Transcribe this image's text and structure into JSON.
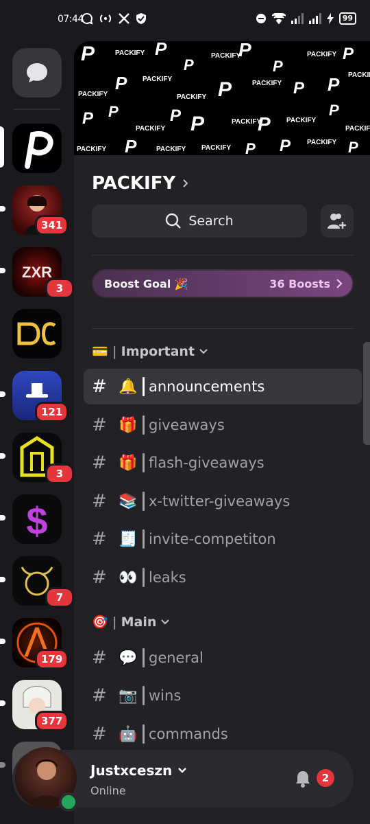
{
  "status_bar": {
    "time": "07:44",
    "battery": "99"
  },
  "rail": {
    "servers": [
      {
        "name": "PACKIFY",
        "badge": "",
        "active": true,
        "color": "#000000"
      },
      {
        "name": "server-2",
        "badge": "341",
        "color": "#5a1010"
      },
      {
        "name": "ZXR",
        "badge": "3",
        "color": "#3a0808"
      },
      {
        "name": "DC",
        "badge": "",
        "color": "#050505"
      },
      {
        "name": "server-5",
        "badge": "121",
        "color": "#1e2f8f"
      },
      {
        "name": "server-6",
        "badge": "3",
        "color": "#0a0a0a"
      },
      {
        "name": "server-7",
        "badge": "",
        "color": "#0a0a0a"
      },
      {
        "name": "server-8",
        "badge": "7",
        "color": "#0a0a0a"
      },
      {
        "name": "server-9",
        "badge": "179",
        "color": "#1a0500"
      },
      {
        "name": "server-10",
        "badge": "377",
        "color": "#e8e6e0"
      }
    ]
  },
  "server": {
    "name": "PACKIFY",
    "search_label": "Search",
    "boost": {
      "label": "Boost Goal 🎉",
      "count": "36 Boosts"
    }
  },
  "categories": [
    {
      "emoji": "💳",
      "label": "Important",
      "channels": [
        {
          "emoji": "🔔",
          "name": "announcements",
          "active": true
        },
        {
          "emoji": "🎁",
          "name": "giveaways"
        },
        {
          "emoji": "🎁",
          "name": "flash-giveaways"
        },
        {
          "emoji": "📚",
          "name": "x-twitter-giveaways"
        },
        {
          "emoji": "🧾",
          "name": "invite-competiton"
        },
        {
          "emoji": "👀",
          "name": "leaks"
        }
      ]
    },
    {
      "emoji": "🎯",
      "label": "Main",
      "channels": [
        {
          "emoji": "💬",
          "name": "general"
        },
        {
          "emoji": "📷",
          "name": "wins"
        },
        {
          "emoji": "🤖",
          "name": "commands"
        }
      ]
    }
  ],
  "user": {
    "name": "Justxceszn",
    "status": "Online",
    "notifications": "2"
  },
  "colors": {
    "accent_red": "#e5363b",
    "online_green": "#23a55a",
    "boost_gradient_start": "#4a3150",
    "boost_gradient_end": "#7a4680"
  }
}
